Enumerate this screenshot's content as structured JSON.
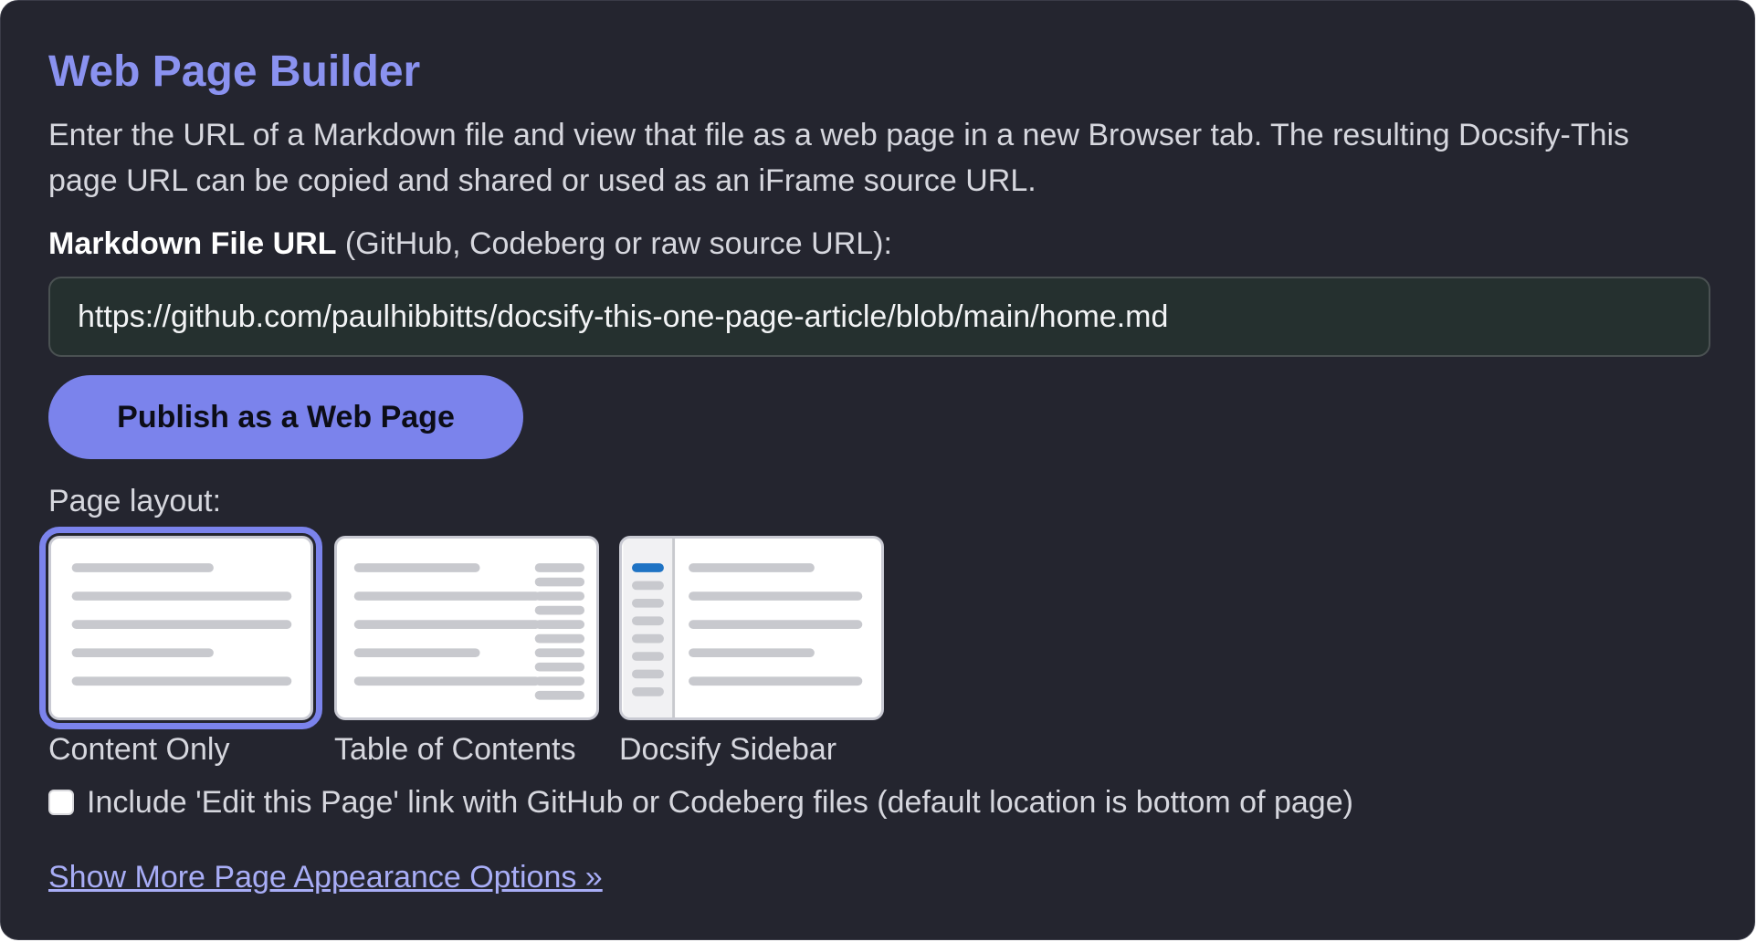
{
  "builder": {
    "title": "Web Page Builder",
    "description": "Enter the URL of a Markdown file and view that file as a web page in a new Browser tab. The resulting Docsify-This page URL can be copied and shared or used as an iFrame source URL.",
    "url_field": {
      "label_strong": "Markdown File URL",
      "label_hint": "(GitHub, Codeberg or raw source URL):",
      "value": "https://github.com/paulhibbitts/docsify-this-one-page-article/blob/main/home.md"
    },
    "publish_button": "Publish as a Web Page",
    "layout": {
      "label": "Page layout:",
      "options": [
        {
          "label": "Content Only",
          "selected": true
        },
        {
          "label": "Table of Contents",
          "selected": false
        },
        {
          "label": "Docsify Sidebar",
          "selected": false
        }
      ]
    },
    "edit_link": {
      "label": "Include 'Edit this Page' link with GitHub or Codeberg files (default location is bottom of page)",
      "checked": false
    },
    "more_options_link": "Show More Page Appearance Options »"
  },
  "colors": {
    "background": "#24252f",
    "accent": "#7b83ec",
    "title": "#8a92f0",
    "link": "#a8adf6",
    "sidebar_highlight": "#1f73c4"
  }
}
